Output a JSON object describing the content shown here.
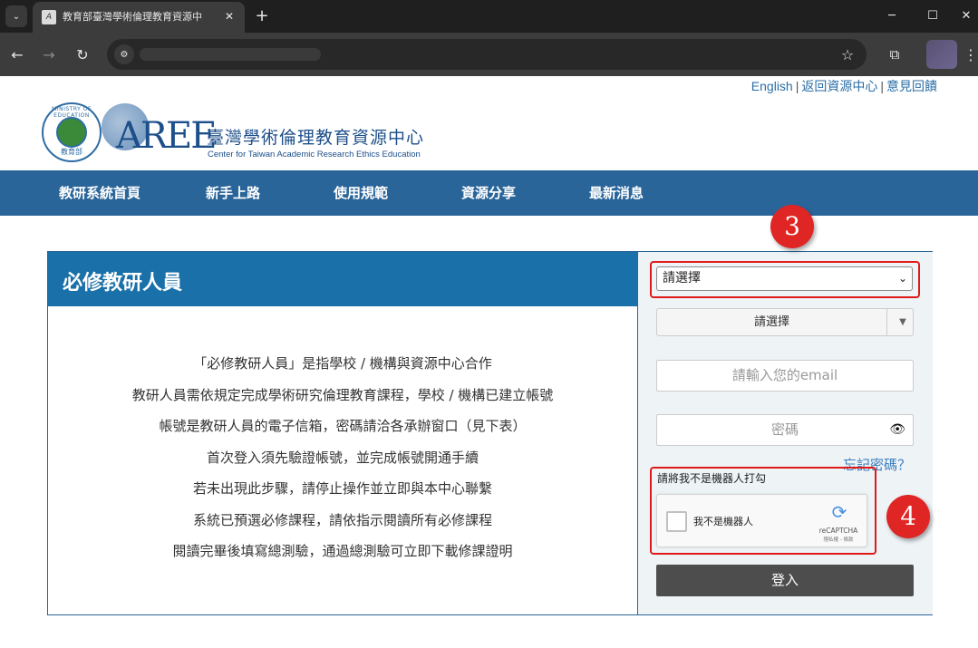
{
  "browser": {
    "tab_title": "教育部臺灣學術倫理教育資源中",
    "tab_close": "✕",
    "new_tab": "+",
    "tab_list": "⌄",
    "minimize": "─",
    "maximize": "☐",
    "close": "✕",
    "back": "←",
    "forward": "→",
    "reload": "↻",
    "star": "☆",
    "extensions": "⧉",
    "menu": "⋮"
  },
  "header": {
    "links": [
      "English",
      "返回資源中心",
      "意見回饋"
    ],
    "separator": "|",
    "seal_ring": "MINISTRY OF EDUCATION",
    "seal_text": "教育部",
    "logo_letters": "AREE",
    "site_title": "臺灣學術倫理教育資源中心",
    "site_subtitle": "Center for Taiwan Academic Research Ethics Education"
  },
  "nav": {
    "items": [
      "教研系統首頁",
      "新手上路",
      "使用規範",
      "資源分享",
      "最新消息"
    ]
  },
  "panel": {
    "title": "必修教研人員",
    "lines": [
      "「必修教研人員」是指學校 / 機構與資源中心合作",
      "教研人員需依規定完成學術研究倫理教育課程，學校 / 機構已建立帳號",
      "帳號是教研人員的電子信箱，密碼請洽各承辦窗口（見下表）",
      "首次登入須先驗證帳號，並完成帳號開通手續",
      "若未出現此步驟，請停止操作並立即與本中心聯繫",
      "系統已預選必修課程，請依指示閱讀所有必修課程",
      "閱讀完畢後填寫總測驗，通過總測驗可立即下載修課證明"
    ]
  },
  "login": {
    "select_primary": "請選擇",
    "select_secondary": "請選擇",
    "email_placeholder": "請輸入您的email",
    "password_placeholder": "密碼",
    "forgot": "忘記密碼？",
    "recaptcha_prompt": "請將我不是機器人打勾",
    "recaptcha_label": "我不是機器人",
    "recaptcha_brand": "reCAPTCHA",
    "recaptcha_terms": "隱私權 - 條款",
    "submit": "登入"
  },
  "annotations": {
    "badge_3": "3",
    "badge_4": "4"
  },
  "colors": {
    "nav_bg": "#2a6599",
    "panel_head": "#1a70a8",
    "highlight": "#e01a1a",
    "login_button": "#4d4d4d"
  }
}
